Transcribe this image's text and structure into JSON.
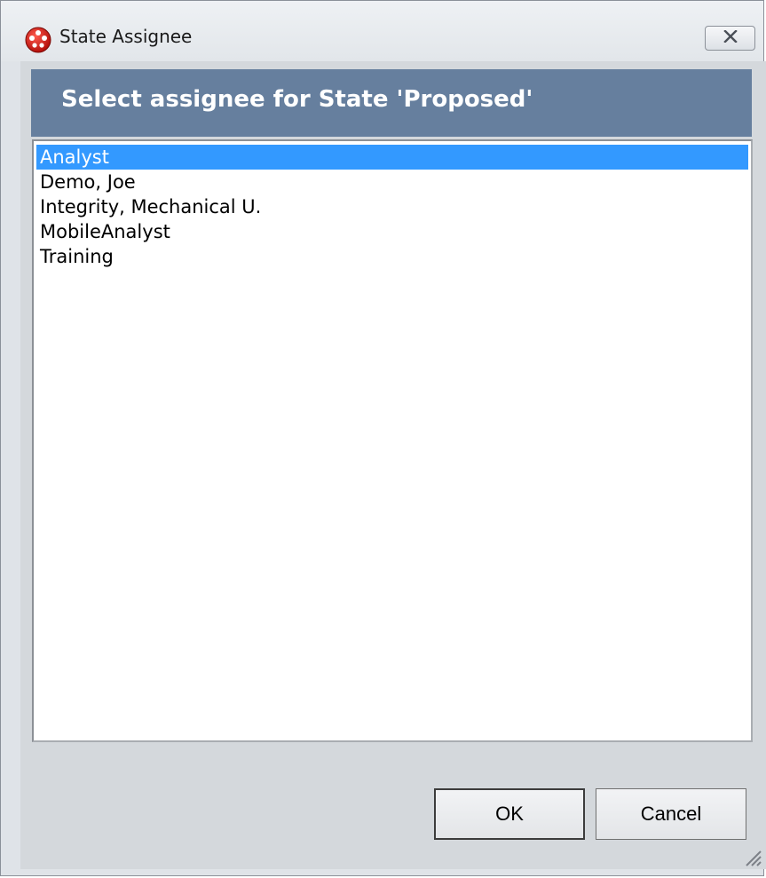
{
  "window": {
    "title": "State Assignee",
    "icon": "app-logo-icon",
    "close_icon": "close-icon"
  },
  "header": {
    "text": "Select assignee for State 'Proposed'"
  },
  "assignees": {
    "items": [
      "Analyst",
      "Demo, Joe",
      "Integrity, Mechanical U.",
      "MobileAnalyst",
      "Training"
    ],
    "selected": "Analyst"
  },
  "buttons": {
    "ok": "OK",
    "cancel": "Cancel"
  },
  "colors": {
    "header_bg": "#667f9e",
    "selection": "#3399ff",
    "frame": "#d4d8dc"
  }
}
